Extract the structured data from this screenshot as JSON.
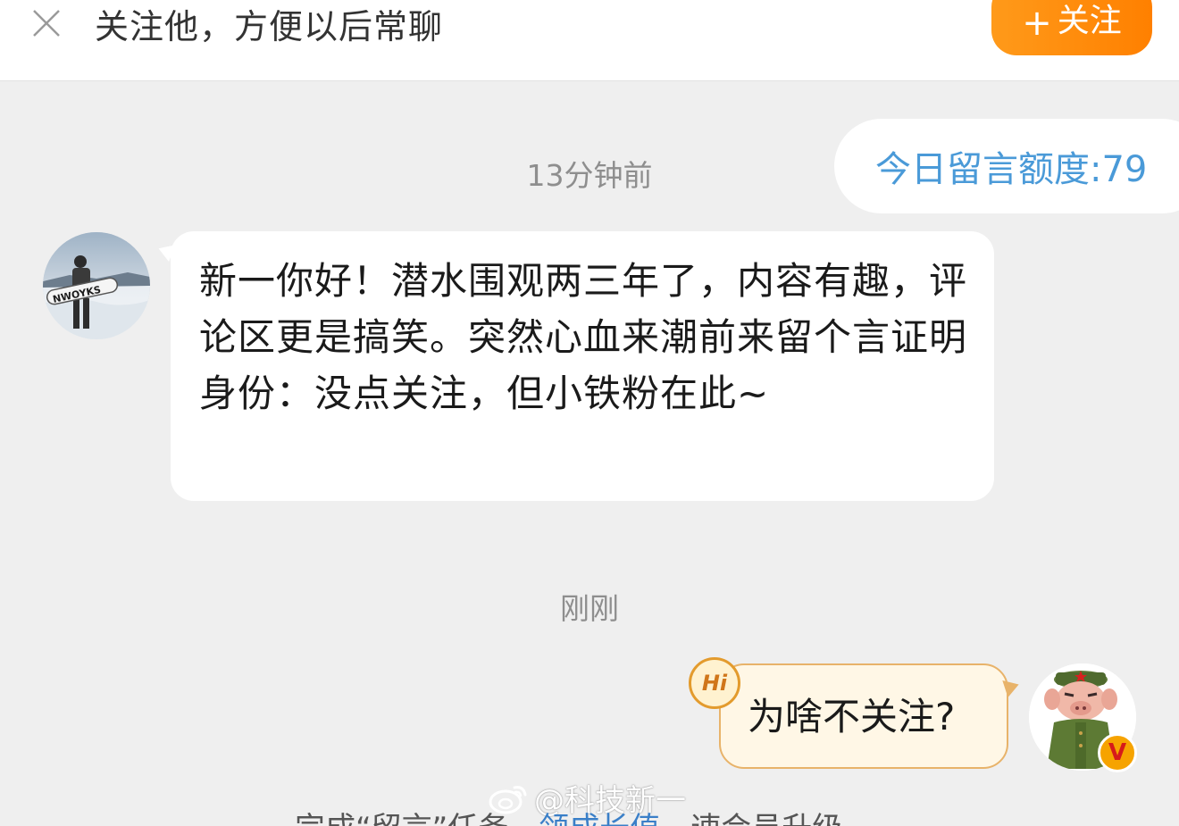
{
  "header": {
    "follow_prompt": "关注他，方便以后常聊",
    "follow_button_plus": "+",
    "follow_button_label": "关注"
  },
  "quota": {
    "label": "今日留言额度:79"
  },
  "messages": [
    {
      "timestamp": "13分钟前",
      "side": "left",
      "text": "新一你好！潜水围观两三年了，内容有趣，评论区更是搞笑。突然心血来潮前来留个言证明身份：没点关注，但小铁粉在此~"
    },
    {
      "timestamp": "刚刚",
      "side": "right",
      "badge": "Hi",
      "text": "为啥不关注?"
    }
  ],
  "verified_badge": "V",
  "watermark": {
    "text": "@科技新一"
  },
  "bottom_partial": {
    "text_a": "完成“留言”任务，",
    "link": "领成长值",
    "text_b": "，速会员升级"
  },
  "colors": {
    "follow_orange": "#ff8c0a",
    "quota_blue": "#4a9ad8",
    "chat_bg": "#efefef",
    "right_bubble_bg": "#fff7e6",
    "right_bubble_border": "#e8b36a"
  }
}
